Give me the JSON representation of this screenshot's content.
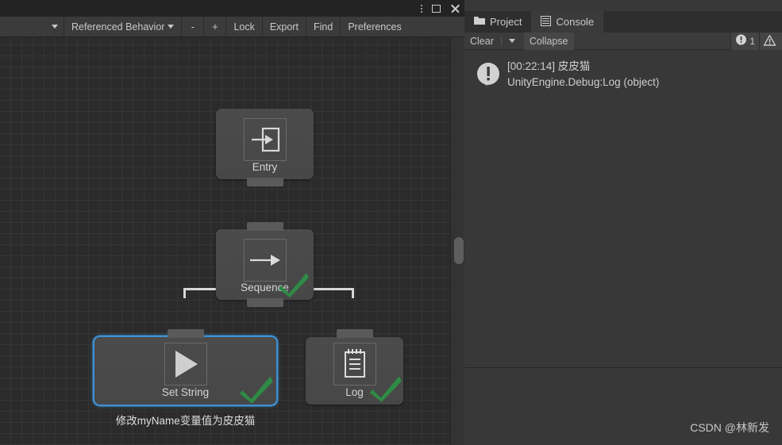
{
  "window": {
    "controls": [
      {
        "name": "kebab-menu-icon",
        "label": "⋮"
      },
      {
        "name": "maximize-icon",
        "label": "□"
      },
      {
        "name": "close-icon",
        "label": "✕"
      }
    ]
  },
  "graph_toolbar": {
    "behavior_dropdown_value": "",
    "referenced_behaviors_label": "Referenced Behavior",
    "zoom_out_label": "-",
    "zoom_in_label": "+",
    "lock_label": "Lock",
    "export_label": "Export",
    "find_label": "Find",
    "preferences_label": "Preferences"
  },
  "graph": {
    "nodes": [
      {
        "id": "entry",
        "label": "Entry",
        "icon": "enter-arrow-icon",
        "selected": false,
        "checked": false,
        "caption": ""
      },
      {
        "id": "sequence",
        "label": "Sequence",
        "icon": "right-arrow-icon",
        "selected": false,
        "checked": true,
        "caption": ""
      },
      {
        "id": "set-string",
        "label": "Set String",
        "icon": "play-triangle-icon",
        "selected": true,
        "checked": true,
        "caption": "修改myName变量值为皮皮猫"
      },
      {
        "id": "log",
        "label": "Log",
        "icon": "notepad-icon",
        "selected": false,
        "checked": true,
        "caption": ""
      }
    ]
  },
  "console": {
    "tabs": [
      {
        "label": "Project",
        "icon": "folder-icon",
        "active": false
      },
      {
        "label": "Console",
        "icon": "console-icon",
        "active": true
      }
    ],
    "toolbar": {
      "clear_label": "Clear",
      "collapse_label": "Collapse"
    },
    "counters": [
      {
        "name": "log-count",
        "icon": "log-badge-icon",
        "value": "1"
      },
      {
        "name": "warning-count",
        "icon": "warning-triangle-icon",
        "value": ""
      }
    ],
    "entries": [
      {
        "icon": "log-badge-icon",
        "line1": "[00:22:14] 皮皮猫",
        "line2": "UnityEngine.Debug:Log (object)"
      }
    ]
  },
  "annotation": {
    "arrow_color": "#ee1f26"
  },
  "watermark": {
    "text": "CSDN @林新发"
  },
  "colors": {
    "accent_selection": "#3d8fd1",
    "check_green": "#2e8b45",
    "panel_bg": "#383838",
    "canvas_bg": "#2b2b2b"
  }
}
